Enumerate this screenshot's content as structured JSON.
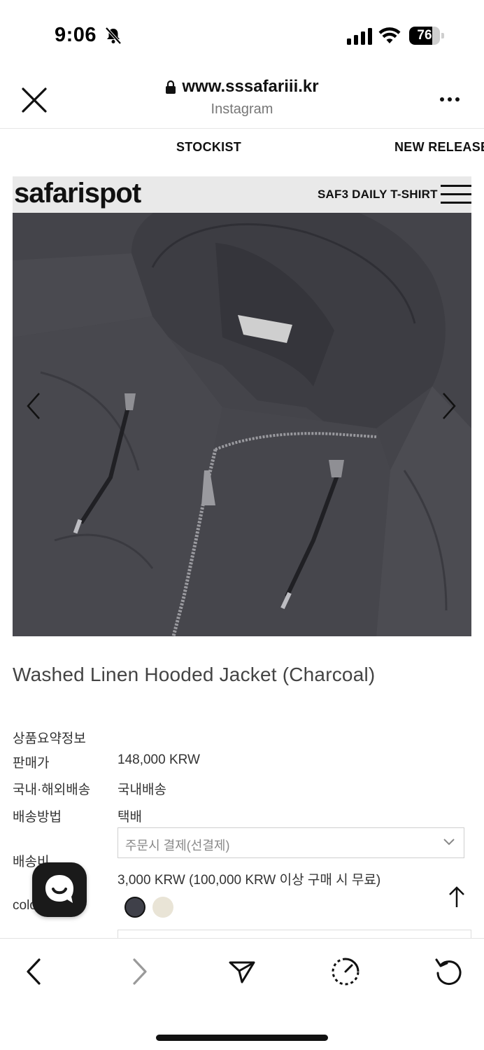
{
  "status_bar": {
    "time": "9:06",
    "battery": "76",
    "battery_level": 0.76
  },
  "browser": {
    "url": "www.sssafariii.kr",
    "source": "Instagram"
  },
  "site_nav": {
    "items": [
      "STOCKIST",
      "NEW RELEASE"
    ]
  },
  "banner": {
    "logo": "safarispot",
    "text": "SAF3 DAILY T-SHIRT"
  },
  "product": {
    "title": "Washed Linen Hooded Jacket (Charcoal)",
    "summary_label": "상품요약정보",
    "price_label": "판매가",
    "price_value": "148,000 KRW",
    "ship_scope_label": "국내·해외배송",
    "ship_scope_value": "국내배송",
    "ship_method_label": "배송방법",
    "ship_method_value": "택배",
    "ship_fee_label": "배송비",
    "ship_fee_select": "주문시 결제(선결제)",
    "ship_fee_value": "3,000 KRW (100,000 KRW 이상 구매 시 무료)",
    "color_label": "color",
    "swatches": [
      "#3f4049",
      "#e9e4d6"
    ]
  },
  "colors": {
    "hero_fabric": "#47474b",
    "accent": "#111111"
  },
  "icons": {
    "close": "close-icon",
    "lock": "lock-icon",
    "more": "more-icon",
    "back": "back-icon",
    "forward": "forward-icon",
    "share": "send-icon",
    "speed": "speed-icon",
    "reload": "reload-icon",
    "chat": "chat-icon",
    "scroll_top": "arrow-up-icon"
  }
}
